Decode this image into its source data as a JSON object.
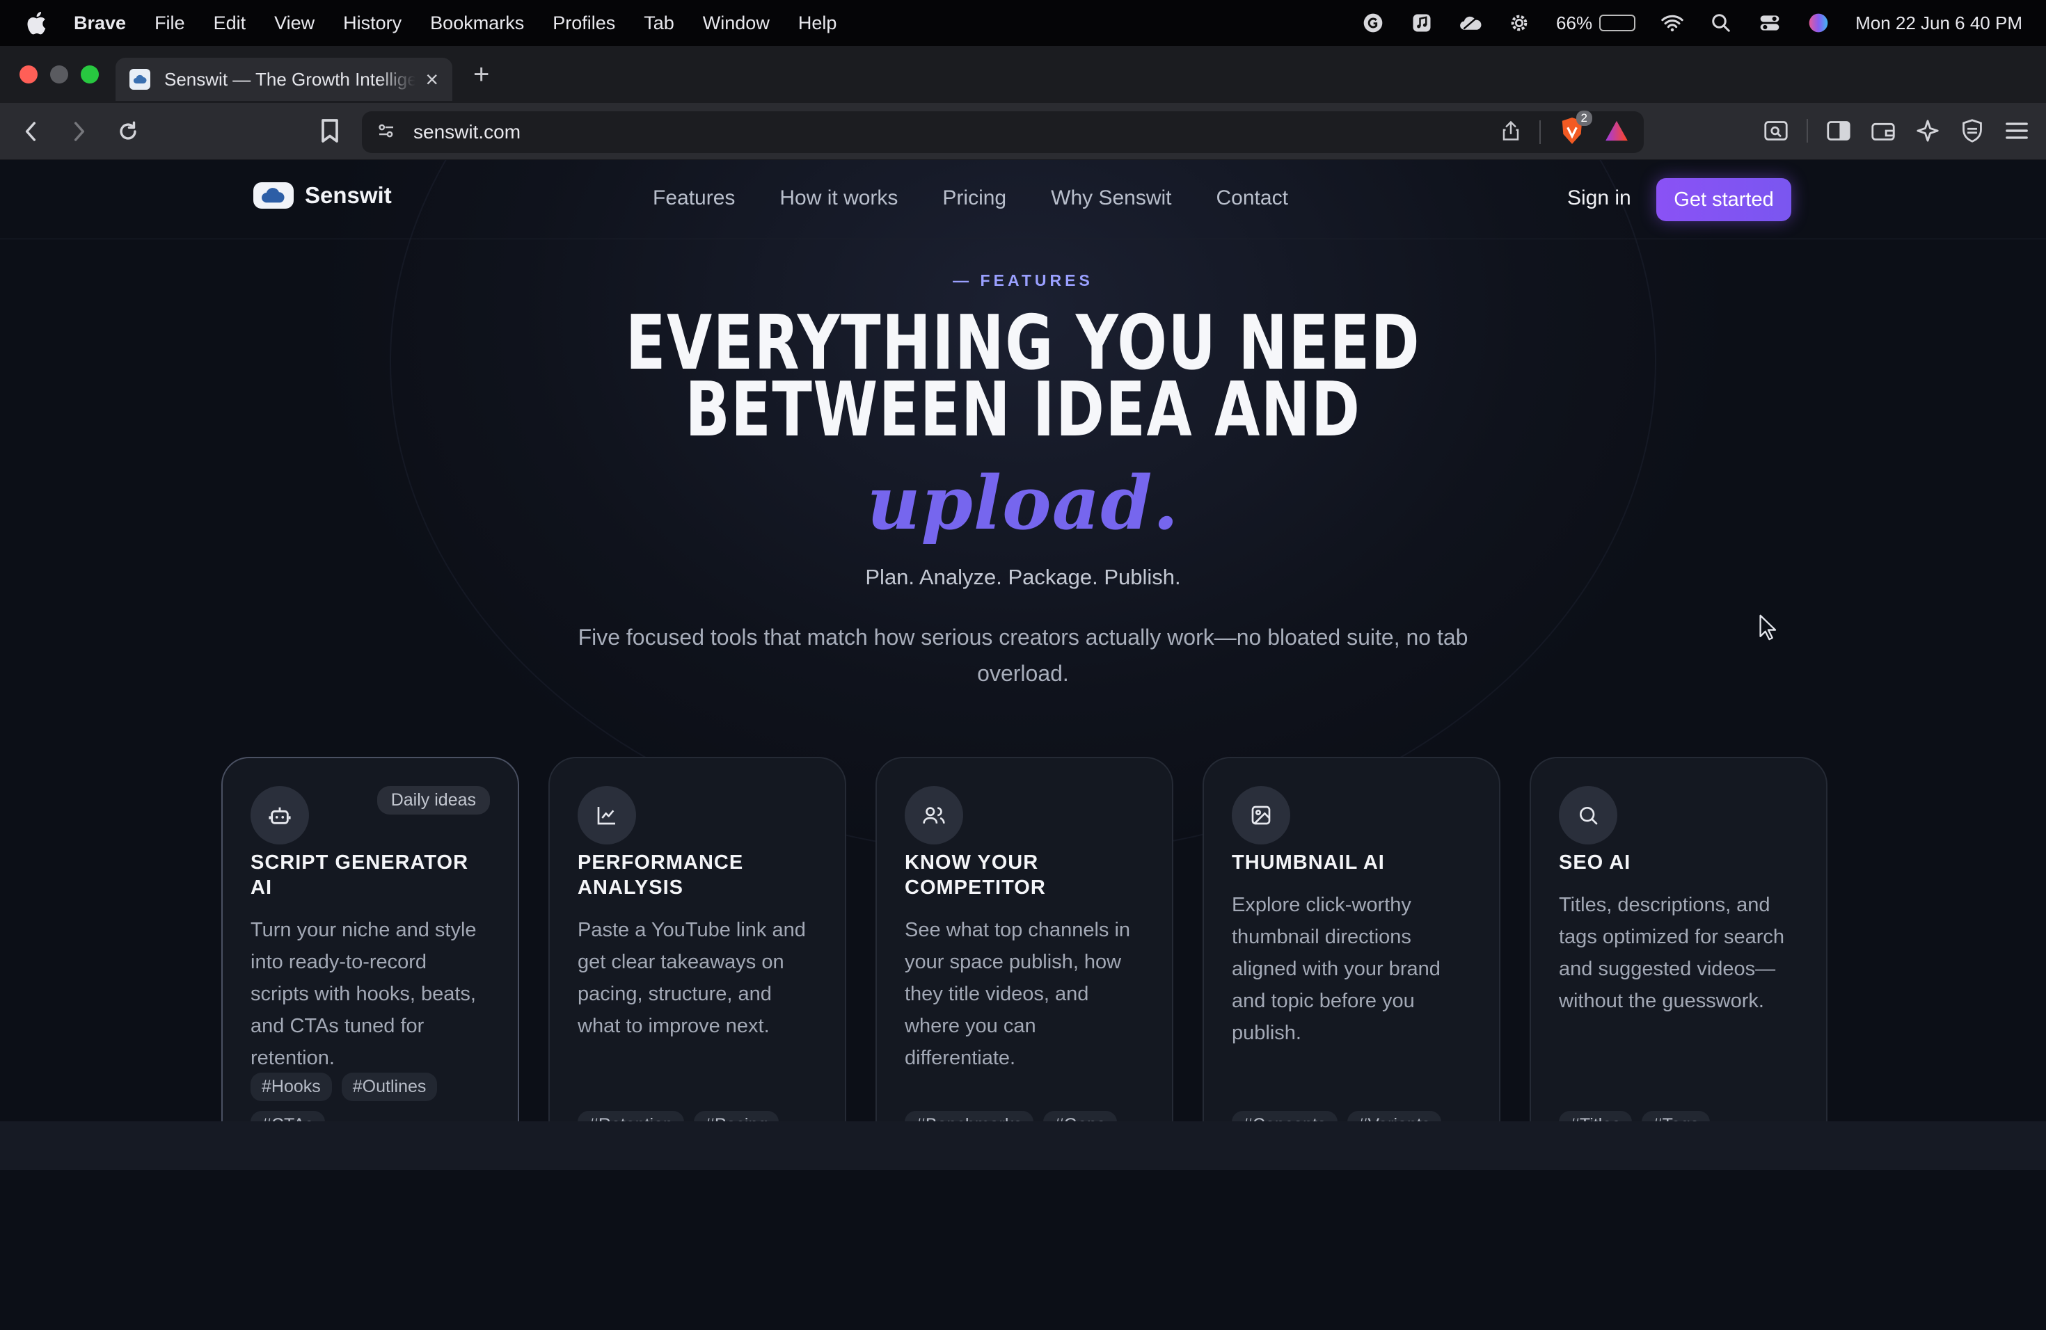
{
  "menubar": {
    "app": "Brave",
    "items": [
      "File",
      "Edit",
      "View",
      "History",
      "Bookmarks",
      "Profiles",
      "Tab",
      "Window",
      "Help"
    ],
    "battery_percent": "66%",
    "battery_level": 0.66,
    "datetime": "Mon 22 Jun  6 40 PM"
  },
  "browser": {
    "tab_title": "Senswit — The Growth Intelligence",
    "url": "senswit.com",
    "shield_count": "2"
  },
  "site": {
    "brand": "Senswit",
    "nav": [
      "Features",
      "How it works",
      "Pricing",
      "Why Senswit",
      "Contact"
    ],
    "sign_in": "Sign in",
    "get_started": "Get started"
  },
  "hero": {
    "eyebrow": "— FEATURES",
    "line1": "EVERYTHING YOU NEED",
    "line2": "BETWEEN IDEA AND",
    "accent": "upload.",
    "tagline": "Plan. Analyze. Package. Publish.",
    "description": "Five focused tools that match how serious creators actually work—no bloated suite, no tab overload."
  },
  "cards": [
    {
      "title": "Script Generator AI",
      "badge": "Daily ideas",
      "icon": "robot-icon",
      "body": "Turn your niche and style into ready-to-record scripts with hooks, beats, and CTAs tuned for retention.",
      "tags": [
        "#Hooks",
        "#Outlines",
        "#CTAs"
      ]
    },
    {
      "title": "Performance Analysis",
      "badge": "",
      "icon": "line-chart-icon",
      "body": "Paste a YouTube link and get clear takeaways on pacing, structure, and what to improve next.",
      "tags": [
        "#Retention",
        "#Pacing"
      ]
    },
    {
      "title": "Know Your Competitor",
      "badge": "",
      "icon": "users-icon",
      "body": "See what top channels in your space publish, how they title videos, and where you can differentiate.",
      "tags": [
        "#Benchmarks",
        "#Gaps"
      ]
    },
    {
      "title": "Thumbnail AI",
      "badge": "",
      "icon": "image-icon",
      "body": "Explore click-worthy thumbnail directions aligned with your brand and topic before you publish.",
      "tags": [
        "#Concepts",
        "#Variants"
      ]
    },
    {
      "title": "SEO AI",
      "badge": "",
      "icon": "search-icon",
      "body": "Titles, descriptions, and tags optimized for search and suggested videos—without the guesswork.",
      "tags": [
        "#Titles",
        "#Tags"
      ]
    }
  ],
  "colors": {
    "accent": "#7666ee",
    "cta": "#8a52f5",
    "background": "#0c0f17"
  }
}
